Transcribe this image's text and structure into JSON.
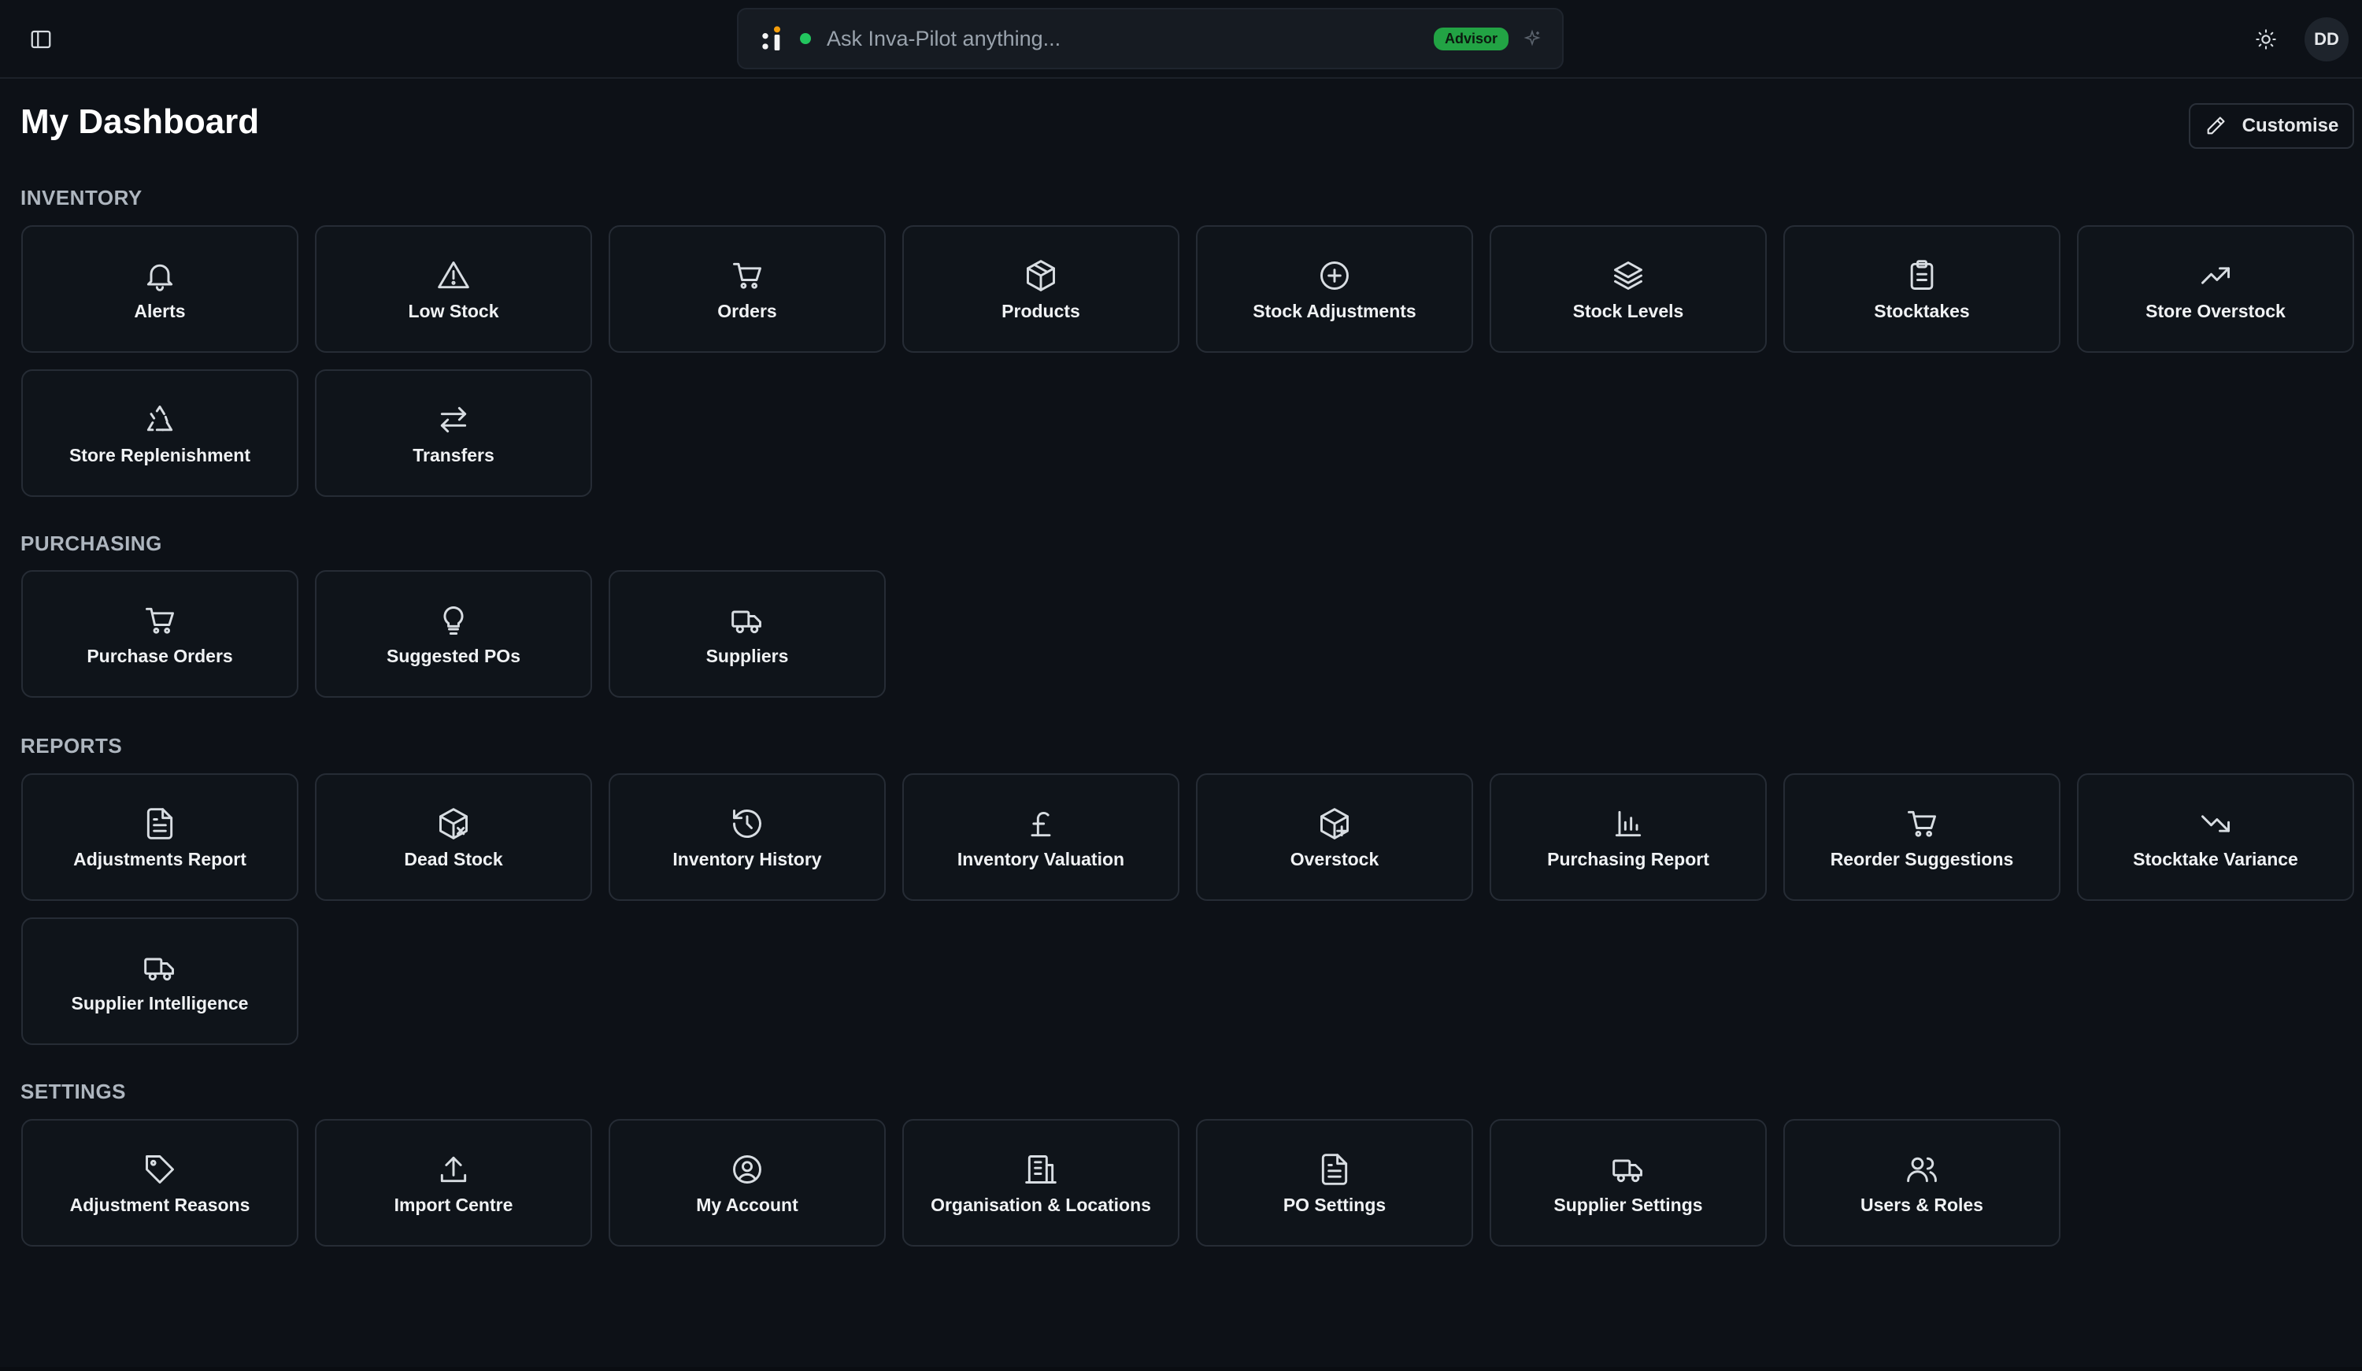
{
  "header": {
    "search_placeholder": "Ask Inva-Pilot anything...",
    "mode_badge": "Advisor",
    "user_initials": "DD"
  },
  "page": {
    "title": "My Dashboard",
    "customise_label": "Customise"
  },
  "sections": {
    "inventory": {
      "title": "INVENTORY",
      "tiles": [
        {
          "label": "Alerts",
          "icon": "bell-icon"
        },
        {
          "label": "Low Stock",
          "icon": "warning-icon"
        },
        {
          "label": "Orders",
          "icon": "cart-icon"
        },
        {
          "label": "Products",
          "icon": "box-icon"
        },
        {
          "label": "Stock Adjustments",
          "icon": "plus-circle-icon"
        },
        {
          "label": "Stock Levels",
          "icon": "layers-icon"
        },
        {
          "label": "Stocktakes",
          "icon": "clipboard-icon"
        },
        {
          "label": "Store Overstock",
          "icon": "trending-up-icon"
        },
        {
          "label": "Store Replenishment",
          "icon": "recycle-icon"
        },
        {
          "label": "Transfers",
          "icon": "arrows-swap-icon"
        }
      ]
    },
    "purchasing": {
      "title": "PURCHASING",
      "tiles": [
        {
          "label": "Purchase Orders",
          "icon": "cart-icon"
        },
        {
          "label": "Suggested POs",
          "icon": "lightbulb-icon"
        },
        {
          "label": "Suppliers",
          "icon": "truck-icon"
        }
      ]
    },
    "reports": {
      "title": "REPORTS",
      "tiles": [
        {
          "label": "Adjustments Report",
          "icon": "file-text-icon"
        },
        {
          "label": "Dead Stock",
          "icon": "box-x-icon"
        },
        {
          "label": "Inventory History",
          "icon": "history-icon"
        },
        {
          "label": "Inventory Valuation",
          "icon": "pound-icon"
        },
        {
          "label": "Overstock",
          "icon": "box-plus-icon"
        },
        {
          "label": "Purchasing Report",
          "icon": "bar-chart-icon"
        },
        {
          "label": "Reorder Suggestions",
          "icon": "cart-icon"
        },
        {
          "label": "Stocktake Variance",
          "icon": "trending-down-icon"
        },
        {
          "label": "Supplier Intelligence",
          "icon": "truck-icon"
        }
      ]
    },
    "settings": {
      "title": "SETTINGS",
      "tiles": [
        {
          "label": "Adjustment Reasons",
          "icon": "tag-icon"
        },
        {
          "label": "Import Centre",
          "icon": "upload-icon"
        },
        {
          "label": "My Account",
          "icon": "user-circle-icon"
        },
        {
          "label": "Organisation & Locations",
          "icon": "building-icon"
        },
        {
          "label": "PO Settings",
          "icon": "file-text-icon"
        },
        {
          "label": "Supplier Settings",
          "icon": "truck-icon"
        },
        {
          "label": "Users & Roles",
          "icon": "users-icon"
        }
      ]
    }
  },
  "colors": {
    "background": "#0d1117",
    "tile_background": "#0f141a",
    "tile_border": "#262c35",
    "status_green": "#22c55e",
    "advisor_badge": "#22a344"
  }
}
